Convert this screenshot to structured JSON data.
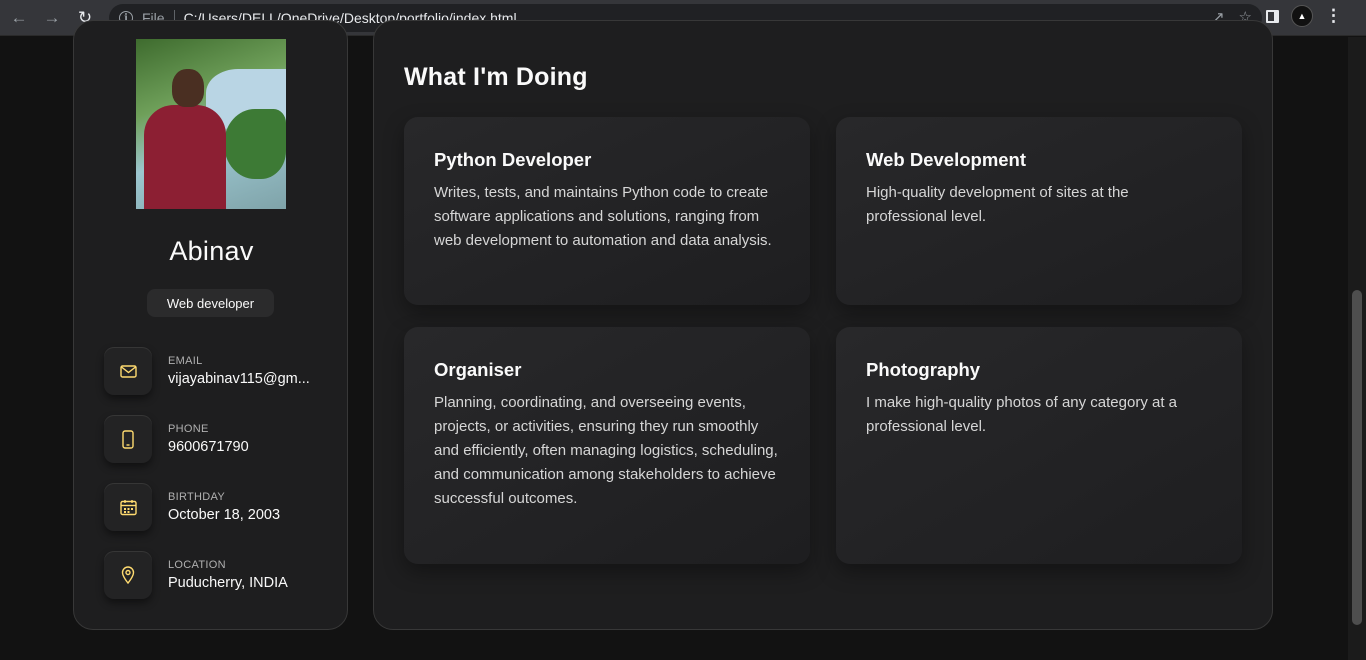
{
  "browser": {
    "scheme": "File",
    "url": "C:/Users/DELL/OneDrive/Desktop/portfolio/index.html"
  },
  "sidebar": {
    "name": "Abinav",
    "title": "Web developer",
    "contacts": [
      {
        "label": "Email",
        "value": "vijayabinav115@gm...",
        "icon": "mail-icon"
      },
      {
        "label": "Phone",
        "value": "9600671790",
        "icon": "phone-icon"
      },
      {
        "label": "Birthday",
        "value": "October 18, 2003",
        "icon": "calendar-icon"
      },
      {
        "label": "Location",
        "value": "Puducherry, INDIA",
        "icon": "location-icon"
      }
    ]
  },
  "main": {
    "section_title": "What I'm Doing",
    "services": [
      {
        "title": "Python Developer",
        "text": "Writes, tests, and maintains Python code to create software applications and solutions, ranging from web development to automation and data analysis."
      },
      {
        "title": "Web Development",
        "text": "High-quality development of sites at the professional level."
      },
      {
        "title": "Organiser",
        "text": "Planning, coordinating, and overseeing events, projects, or activities, ensuring they run smoothly and efficiently, often managing logistics, scheduling, and communication among stakeholders to achieve successful outcomes."
      },
      {
        "title": "Photography",
        "text": "I make high-quality photos of any category at a professional level."
      }
    ]
  },
  "colors": {
    "background": "#121212",
    "card": "#1e1e1f",
    "accent": "#ffdb70"
  }
}
